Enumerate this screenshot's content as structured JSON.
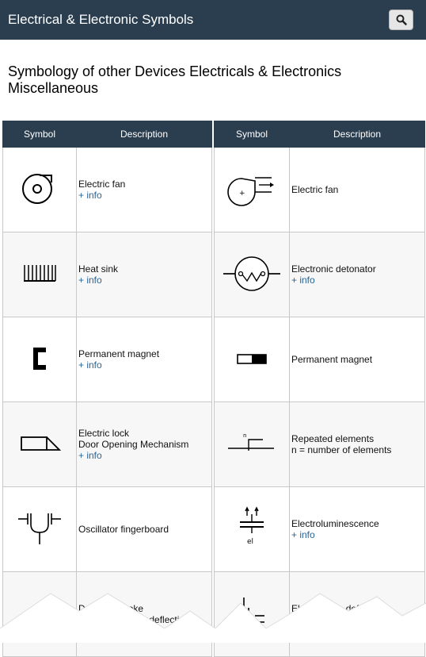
{
  "header": {
    "title": "Electrical & Electronic Symbols",
    "search_icon": "search-icon"
  },
  "page": {
    "heading": "Symbology of other Devices Electricals & Electronics Miscellaneous"
  },
  "tables": {
    "headers": {
      "symbol": "Symbol",
      "description": "Description"
    },
    "info_label": "+ info",
    "left": [
      {
        "icon": "electric-fan-icon",
        "lines": [
          "Electric fan"
        ],
        "info": true
      },
      {
        "icon": "heat-sink-icon",
        "lines": [
          "Heat sink"
        ],
        "info": true
      },
      {
        "icon": "permanent-magnet-icon",
        "lines": [
          "Permanent magnet"
        ],
        "info": true
      },
      {
        "icon": "electric-lock-icon",
        "lines": [
          "Electric lock",
          "Door Opening Mechanism"
        ],
        "info": true
      },
      {
        "icon": "oscillator-fingerboard-icon",
        "lines": [
          "Oscillator fingerboard"
        ],
        "info": false
      },
      {
        "icon": "deflection-yoke-icon",
        "lines": [
          "Deflection yoke",
          "Electromagnetic deflection"
        ],
        "info": false
      }
    ],
    "right": [
      {
        "icon": "electric-fan-alt-icon",
        "lines": [
          "Electric fan"
        ],
        "info": false
      },
      {
        "icon": "electronic-detonator-icon",
        "lines": [
          "Electronic detonator"
        ],
        "info": true
      },
      {
        "icon": "permanent-magnet-alt-icon",
        "lines": [
          "Permanent magnet"
        ],
        "info": false
      },
      {
        "icon": "repeated-elements-icon",
        "lines": [
          "Repeated elements",
          "n = number of elements"
        ],
        "info": false
      },
      {
        "icon": "electroluminescence-icon",
        "lines": [
          "Electroluminescence"
        ],
        "info": true
      },
      {
        "icon": "electrostatic-deflection-icon",
        "lines": [
          "Electrostatic deflection"
        ],
        "info": true
      }
    ],
    "symbol_labels": {
      "repeated_n": "n",
      "electroluminescence_el": "el",
      "fan_plus": "+"
    }
  }
}
